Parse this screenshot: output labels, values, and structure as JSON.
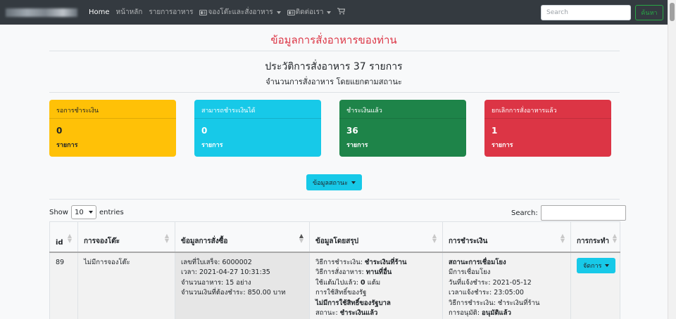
{
  "navbar": {
    "brand": "",
    "links": [
      {
        "label": "Home",
        "active": true
      },
      {
        "label": "หน้าหลัก",
        "active": false
      },
      {
        "label": "รายการอาหาร",
        "active": false
      }
    ],
    "booking_dropdown": "จองโต๊ะและสั่งอาหาร",
    "contact_dropdown": "ติดต่อเรา",
    "search_placeholder": "Search",
    "search_button": "ค้นหา"
  },
  "page_title": "ข้อมูลการสั่งอาหารของท่าน",
  "history_title": "ประวัติการสั่งอาหาร 37 รายการ",
  "history_subtitle": "จำนวนการสั่งอาหาร โดยแยกตามสถานะ",
  "cards": [
    {
      "title": "รอการชำระเงิน",
      "value": "0",
      "unit": "รายการ",
      "color": "#ffc107"
    },
    {
      "title": "สามารถชำระเงินได้",
      "value": "0",
      "unit": "รายการ",
      "color": "#17c9e8"
    },
    {
      "title": "ชำระเงินแล้ว",
      "value": "36",
      "unit": "รายการ",
      "color": "#1e8449"
    },
    {
      "title": "ยกเลิกการสั่งอาหารแล้ว",
      "value": "1",
      "unit": "รายการ",
      "color": "#dc3545"
    }
  ],
  "status_button": "ข้อมูลสถานะ",
  "datatable": {
    "show_label": "Show",
    "page_size": "10",
    "entries_label": "entries",
    "search_label": "Search:"
  },
  "table": {
    "headers": [
      "id",
      "การจองโต๊ะ",
      "ข้อมูลการสั่งซื้อ",
      "ข้อมูลโดยสรุป",
      "การชำระเงิน",
      "การกระทำ"
    ],
    "rows": [
      {
        "id": "89",
        "booking": "ไม่มีการจองโต๊ะ",
        "order_info": [
          "เลขที่ใบเสร็จ: 6000002",
          "เวลา: 2021-04-27 10:31:35",
          "จำนวนอาหาร: 15 อย่าง",
          "จำนวนเงินที่ต้องชำระ: 850.00 บาท"
        ],
        "summary": {
          "l1_label": "วิธีการชำระเงิน: ",
          "l1_value": "ชำระเงินที่ร้าน",
          "l2_label": "วิธีการสั่งอาหาร: ",
          "l2_value": "ทานที่อื่น",
          "l3_label": "ใช้แต้มไปแล้ว: ",
          "l3_value": "0",
          "l3_suffix": " แต้ม",
          "l4": "การใช้สิทธิ์ของรัฐ",
          "l5": "ไม่มีการใช้สิทธิ์ของรัฐบาล",
          "l6_label": "สถานะ: ",
          "l6_value": "ชำระเงินแล้ว"
        },
        "payment": {
          "l1": "สถานะการเชื่อมโยง",
          "l2": "มีการเชื่อมโยง",
          "l3": "วันที่แจ้งชำระ: 2021-05-12",
          "l4": "เวลาแจ้งชำระ: 23:05:00",
          "l5": "วิธีการชำระเงิน: ชำระเงินที่ร้าน",
          "l6_label": "การอนุมัติ: ",
          "l6_value": "อนุมัติแล้ว"
        },
        "action": "จัดการ"
      }
    ]
  }
}
